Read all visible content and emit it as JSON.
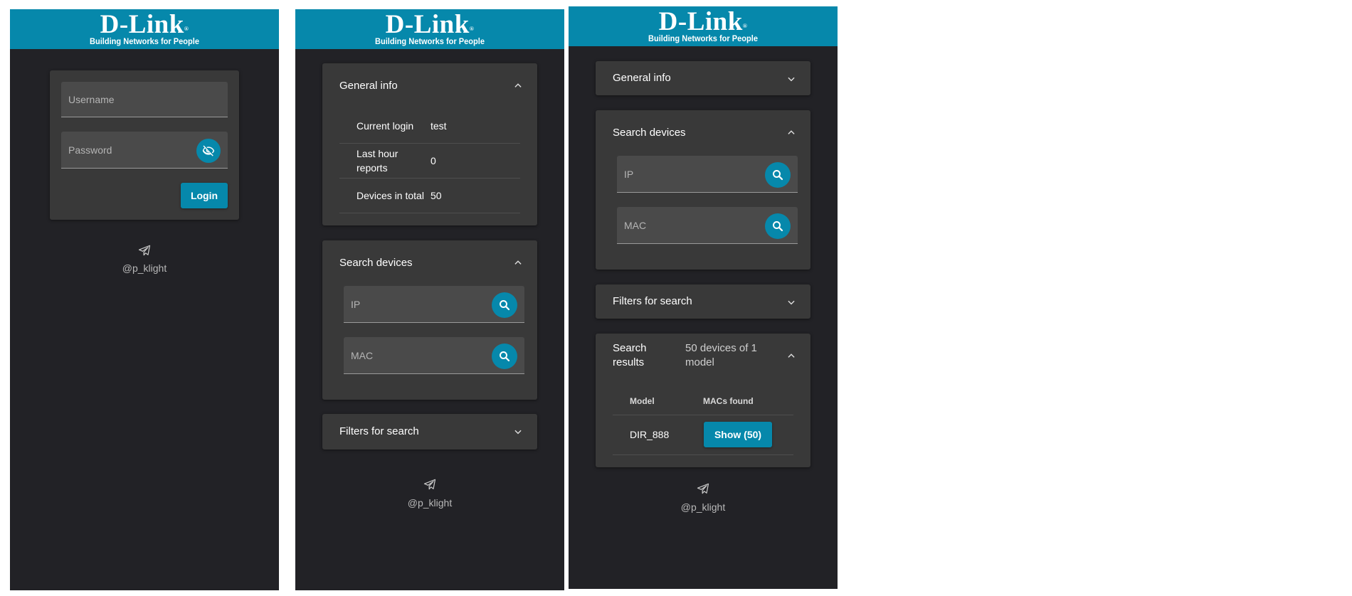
{
  "brand": {
    "logo": "D-Link",
    "registered": "®",
    "tagline": "Building Networks for People",
    "accent": "#0688ab"
  },
  "login": {
    "username_placeholder": "Username",
    "password_placeholder": "Password",
    "login_label": "Login",
    "visibility_icon": "eye-off-icon"
  },
  "footer": {
    "handle": "@p_klight",
    "icon": "telegram-send-icon"
  },
  "general_info": {
    "title": "General info",
    "rows": [
      {
        "key": "Current login",
        "value": "test"
      },
      {
        "key": "Last hour reports",
        "value": "0"
      },
      {
        "key": "Devices in total",
        "value": "50"
      }
    ]
  },
  "search_devices": {
    "title": "Search devices",
    "ip_placeholder": "IP",
    "mac_placeholder": "MAC"
  },
  "filters": {
    "title": "Filters for search"
  },
  "search_results": {
    "title": "Search results",
    "summary": "50 devices of 1 model",
    "columns": [
      "Model",
      "MACs found"
    ],
    "rows": [
      {
        "model": "DIR_888",
        "action": "Show (50)"
      }
    ]
  }
}
